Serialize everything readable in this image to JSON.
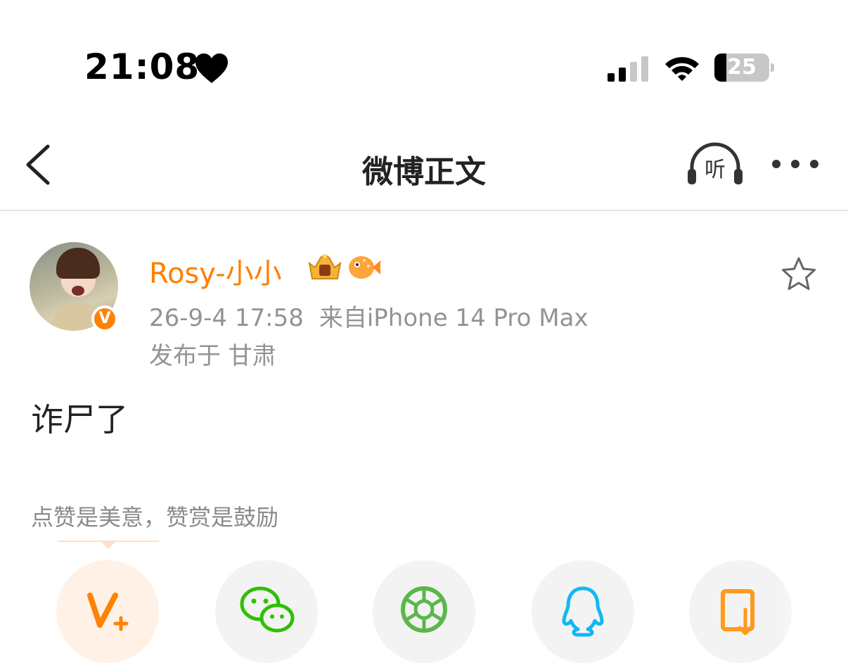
{
  "status_bar": {
    "time": "21:08",
    "battery": "25"
  },
  "nav": {
    "title": "微博正文",
    "listen_label": "听"
  },
  "post": {
    "author": "Rosy-小小",
    "verified_badge": "V",
    "date": "26-9-4 17:58",
    "source": "来自iPhone 14 Pro Max",
    "location": "发布于 甘肃",
    "text": "诈尸了"
  },
  "reward_tip": "点赞是美意，赞赏是鼓励",
  "colors": {
    "brand_orange": "#ff8200",
    "wechat_green": "#2dc100",
    "qq_blue": "#12b7f5"
  },
  "icons": [
    "back-icon",
    "headphones-icon",
    "more-icon",
    "star-icon",
    "crown-icon",
    "fish-icon",
    "vplus-icon",
    "wechat-icon",
    "moments-icon",
    "qq-icon",
    "more-share-icon"
  ]
}
